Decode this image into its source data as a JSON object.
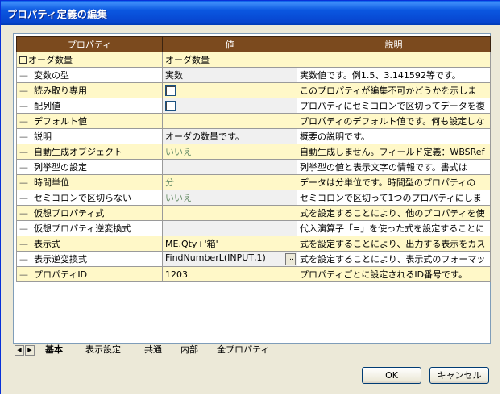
{
  "window": {
    "title": "プロパティ定義の編集"
  },
  "grid": {
    "columns": [
      "プロパティ",
      "値",
      "説明"
    ],
    "rows": [
      {
        "property": "オーダ数量",
        "value": "オーダ数量",
        "description": "",
        "style": "hl",
        "root": true
      },
      {
        "property": "変数の型",
        "value": "実数",
        "description": "実数値です。例1.5、3.141592等です。",
        "style": "wh"
      },
      {
        "property": "読み取り専用",
        "value": "",
        "description": "このプロパティが編集不可かどうかを示しま",
        "style": "hl",
        "checkbox": true
      },
      {
        "property": "配列値",
        "value": "",
        "description": "プロパティにセミコロンで区切ってデータを複",
        "style": "wh",
        "checkbox": true
      },
      {
        "property": "デフォルト値",
        "value": "",
        "description": "プロパティのデフォルト値です。何も設定しな",
        "style": "hl"
      },
      {
        "property": "説明",
        "value": "オーダの数量です。",
        "description": "概要の説明です。",
        "style": "wh"
      },
      {
        "property": "自動生成オブジェクト",
        "value": "いいえ",
        "description": "自動生成しません。フィールド定義：WBSRef",
        "style": "hl",
        "muted": true
      },
      {
        "property": "列挙型の設定",
        "value": "",
        "description": "列挙型の値と表示文字の情報です。書式は",
        "style": "wh"
      },
      {
        "property": "時間単位",
        "value": "分",
        "description": "データは分単位です。時間型のプロパティの",
        "style": "hl",
        "muted": true
      },
      {
        "property": "セミコロンで区切らない",
        "value": "いいえ",
        "description": "セミコロンで区切って1つのプロパティにしま",
        "style": "wh",
        "muted": true
      },
      {
        "property": "仮想プロパティ式",
        "value": "",
        "description": "式を設定することにより、他のプロパティを使",
        "style": "hl"
      },
      {
        "property": "仮想プロパティ逆変換式",
        "value": "",
        "description": "代入演算子「=」を使った式を設定することに",
        "style": "wh"
      },
      {
        "property": "表示式",
        "value": "ME.Qty+'箱'",
        "description": "式を設定することにより、出力する表示をカス",
        "style": "hl"
      },
      {
        "property": "表示逆変換式",
        "value": "FindNumberL(INPUT,1)",
        "description": "式を設定することにより、表示式のフォーマッ",
        "style": "wh",
        "ellipsis": true
      },
      {
        "property": "プロパティID",
        "value": "1203",
        "description": "プロパティごとに設定されるID番号です。",
        "style": "hl"
      }
    ]
  },
  "tabs": [
    "基本",
    "表示設定",
    "共通",
    "内部",
    "全プロパティ"
  ],
  "buttons": {
    "ok": "OK",
    "cancel": "キャンセル"
  }
}
